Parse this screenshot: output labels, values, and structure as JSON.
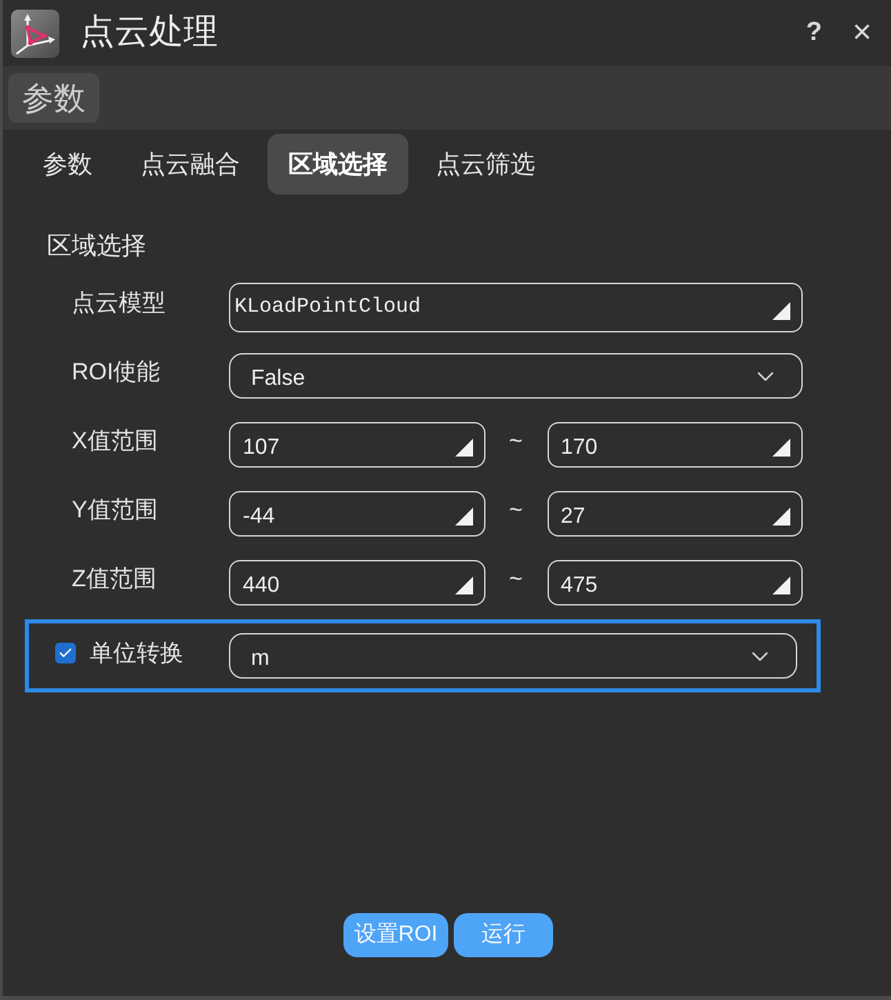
{
  "window": {
    "title": "点云处理",
    "help": "?",
    "close": "×"
  },
  "panel_button": {
    "label": "参数"
  },
  "tabs": [
    {
      "label": "参数",
      "selected": false
    },
    {
      "label": "点云融合",
      "selected": false
    },
    {
      "label": "区域选择",
      "selected": true
    },
    {
      "label": "点云筛选",
      "selected": false
    }
  ],
  "section": {
    "title": "区域选择",
    "fields": [
      {
        "kind": "combo",
        "label": "点云模型",
        "value": "KLoadPointCloud"
      },
      {
        "kind": "dropdown",
        "label": "ROI使能",
        "value": "False"
      },
      {
        "kind": "range",
        "label": "X值范围",
        "min": "107",
        "separator": "~",
        "max": "170"
      },
      {
        "kind": "range",
        "label": "Y值范围",
        "min": "-44",
        "separator": "~",
        "max": "27"
      },
      {
        "kind": "range",
        "label": "Z值范围",
        "min": "440",
        "separator": "~",
        "max": "475"
      },
      {
        "kind": "check_dropdown",
        "label": "单位转换",
        "checked": true,
        "focused": true,
        "value": "m"
      }
    ]
  },
  "buttons": [
    {
      "label": "设置ROI"
    },
    {
      "label": "运行"
    }
  ]
}
